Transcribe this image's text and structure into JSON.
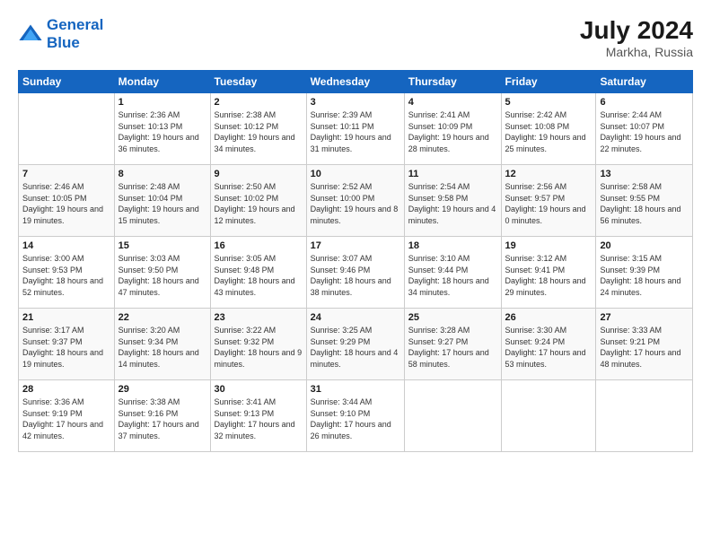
{
  "header": {
    "logo_line1": "General",
    "logo_line2": "Blue",
    "month_year": "July 2024",
    "location": "Markha, Russia"
  },
  "days_of_week": [
    "Sunday",
    "Monday",
    "Tuesday",
    "Wednesday",
    "Thursday",
    "Friday",
    "Saturday"
  ],
  "weeks": [
    [
      {
        "day": "",
        "sunrise": "",
        "sunset": "",
        "daylight": ""
      },
      {
        "day": "1",
        "sunrise": "Sunrise: 2:36 AM",
        "sunset": "Sunset: 10:13 PM",
        "daylight": "Daylight: 19 hours and 36 minutes."
      },
      {
        "day": "2",
        "sunrise": "Sunrise: 2:38 AM",
        "sunset": "Sunset: 10:12 PM",
        "daylight": "Daylight: 19 hours and 34 minutes."
      },
      {
        "day": "3",
        "sunrise": "Sunrise: 2:39 AM",
        "sunset": "Sunset: 10:11 PM",
        "daylight": "Daylight: 19 hours and 31 minutes."
      },
      {
        "day": "4",
        "sunrise": "Sunrise: 2:41 AM",
        "sunset": "Sunset: 10:09 PM",
        "daylight": "Daylight: 19 hours and 28 minutes."
      },
      {
        "day": "5",
        "sunrise": "Sunrise: 2:42 AM",
        "sunset": "Sunset: 10:08 PM",
        "daylight": "Daylight: 19 hours and 25 minutes."
      },
      {
        "day": "6",
        "sunrise": "Sunrise: 2:44 AM",
        "sunset": "Sunset: 10:07 PM",
        "daylight": "Daylight: 19 hours and 22 minutes."
      }
    ],
    [
      {
        "day": "7",
        "sunrise": "Sunrise: 2:46 AM",
        "sunset": "Sunset: 10:05 PM",
        "daylight": "Daylight: 19 hours and 19 minutes."
      },
      {
        "day": "8",
        "sunrise": "Sunrise: 2:48 AM",
        "sunset": "Sunset: 10:04 PM",
        "daylight": "Daylight: 19 hours and 15 minutes."
      },
      {
        "day": "9",
        "sunrise": "Sunrise: 2:50 AM",
        "sunset": "Sunset: 10:02 PM",
        "daylight": "Daylight: 19 hours and 12 minutes."
      },
      {
        "day": "10",
        "sunrise": "Sunrise: 2:52 AM",
        "sunset": "Sunset: 10:00 PM",
        "daylight": "Daylight: 19 hours and 8 minutes."
      },
      {
        "day": "11",
        "sunrise": "Sunrise: 2:54 AM",
        "sunset": "Sunset: 9:58 PM",
        "daylight": "Daylight: 19 hours and 4 minutes."
      },
      {
        "day": "12",
        "sunrise": "Sunrise: 2:56 AM",
        "sunset": "Sunset: 9:57 PM",
        "daylight": "Daylight: 19 hours and 0 minutes."
      },
      {
        "day": "13",
        "sunrise": "Sunrise: 2:58 AM",
        "sunset": "Sunset: 9:55 PM",
        "daylight": "Daylight: 18 hours and 56 minutes."
      }
    ],
    [
      {
        "day": "14",
        "sunrise": "Sunrise: 3:00 AM",
        "sunset": "Sunset: 9:53 PM",
        "daylight": "Daylight: 18 hours and 52 minutes."
      },
      {
        "day": "15",
        "sunrise": "Sunrise: 3:03 AM",
        "sunset": "Sunset: 9:50 PM",
        "daylight": "Daylight: 18 hours and 47 minutes."
      },
      {
        "day": "16",
        "sunrise": "Sunrise: 3:05 AM",
        "sunset": "Sunset: 9:48 PM",
        "daylight": "Daylight: 18 hours and 43 minutes."
      },
      {
        "day": "17",
        "sunrise": "Sunrise: 3:07 AM",
        "sunset": "Sunset: 9:46 PM",
        "daylight": "Daylight: 18 hours and 38 minutes."
      },
      {
        "day": "18",
        "sunrise": "Sunrise: 3:10 AM",
        "sunset": "Sunset: 9:44 PM",
        "daylight": "Daylight: 18 hours and 34 minutes."
      },
      {
        "day": "19",
        "sunrise": "Sunrise: 3:12 AM",
        "sunset": "Sunset: 9:41 PM",
        "daylight": "Daylight: 18 hours and 29 minutes."
      },
      {
        "day": "20",
        "sunrise": "Sunrise: 3:15 AM",
        "sunset": "Sunset: 9:39 PM",
        "daylight": "Daylight: 18 hours and 24 minutes."
      }
    ],
    [
      {
        "day": "21",
        "sunrise": "Sunrise: 3:17 AM",
        "sunset": "Sunset: 9:37 PM",
        "daylight": "Daylight: 18 hours and 19 minutes."
      },
      {
        "day": "22",
        "sunrise": "Sunrise: 3:20 AM",
        "sunset": "Sunset: 9:34 PM",
        "daylight": "Daylight: 18 hours and 14 minutes."
      },
      {
        "day": "23",
        "sunrise": "Sunrise: 3:22 AM",
        "sunset": "Sunset: 9:32 PM",
        "daylight": "Daylight: 18 hours and 9 minutes."
      },
      {
        "day": "24",
        "sunrise": "Sunrise: 3:25 AM",
        "sunset": "Sunset: 9:29 PM",
        "daylight": "Daylight: 18 hours and 4 minutes."
      },
      {
        "day": "25",
        "sunrise": "Sunrise: 3:28 AM",
        "sunset": "Sunset: 9:27 PM",
        "daylight": "Daylight: 17 hours and 58 minutes."
      },
      {
        "day": "26",
        "sunrise": "Sunrise: 3:30 AM",
        "sunset": "Sunset: 9:24 PM",
        "daylight": "Daylight: 17 hours and 53 minutes."
      },
      {
        "day": "27",
        "sunrise": "Sunrise: 3:33 AM",
        "sunset": "Sunset: 9:21 PM",
        "daylight": "Daylight: 17 hours and 48 minutes."
      }
    ],
    [
      {
        "day": "28",
        "sunrise": "Sunrise: 3:36 AM",
        "sunset": "Sunset: 9:19 PM",
        "daylight": "Daylight: 17 hours and 42 minutes."
      },
      {
        "day": "29",
        "sunrise": "Sunrise: 3:38 AM",
        "sunset": "Sunset: 9:16 PM",
        "daylight": "Daylight: 17 hours and 37 minutes."
      },
      {
        "day": "30",
        "sunrise": "Sunrise: 3:41 AM",
        "sunset": "Sunset: 9:13 PM",
        "daylight": "Daylight: 17 hours and 32 minutes."
      },
      {
        "day": "31",
        "sunrise": "Sunrise: 3:44 AM",
        "sunset": "Sunset: 9:10 PM",
        "daylight": "Daylight: 17 hours and 26 minutes."
      },
      {
        "day": "",
        "sunrise": "",
        "sunset": "",
        "daylight": ""
      },
      {
        "day": "",
        "sunrise": "",
        "sunset": "",
        "daylight": ""
      },
      {
        "day": "",
        "sunrise": "",
        "sunset": "",
        "daylight": ""
      }
    ]
  ]
}
